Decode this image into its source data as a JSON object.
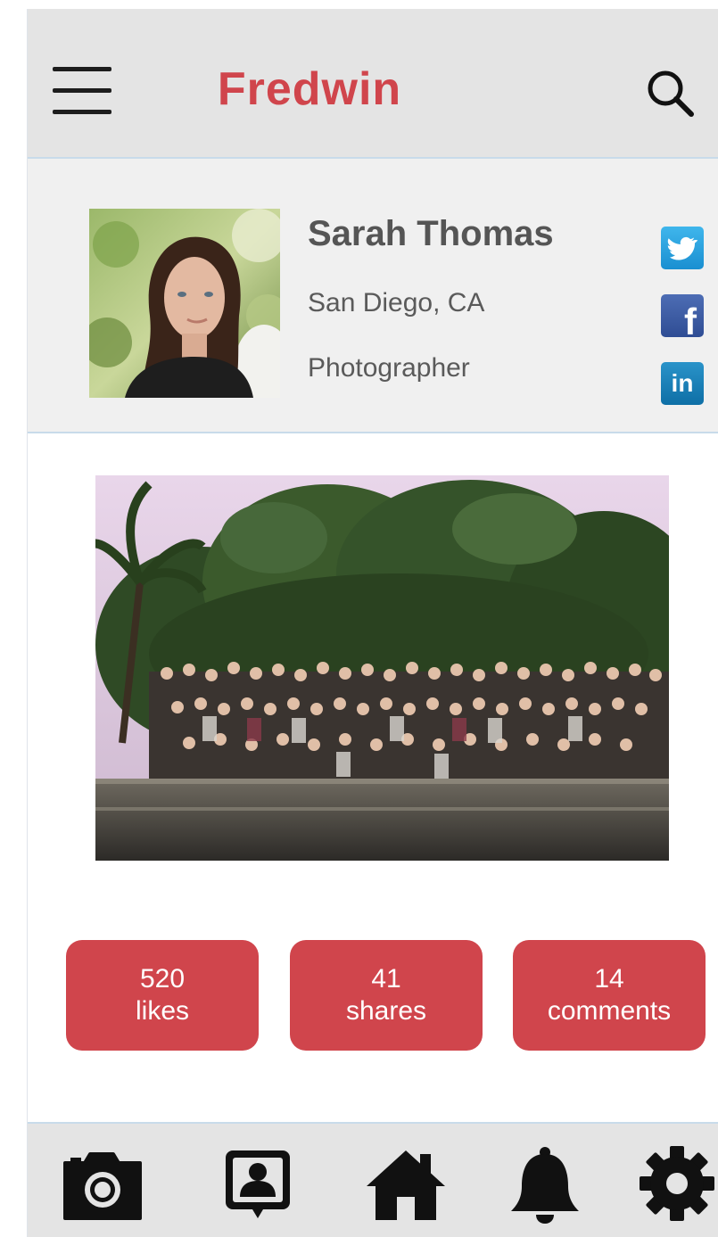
{
  "header": {
    "brand": "Fredwin",
    "menu_icon": "hamburger-menu-icon",
    "search_icon": "search-icon"
  },
  "profile": {
    "name": "Sarah Thomas",
    "location": "San Diego, CA",
    "occupation": "Photographer",
    "social": [
      {
        "icon": "twitter-icon",
        "color": "#1da1f2"
      },
      {
        "icon": "facebook-icon",
        "color": "#3b5998"
      },
      {
        "icon": "linkedin-icon",
        "color": "#0077b5"
      }
    ]
  },
  "photo": {
    "description_icon": "group-photo"
  },
  "stats": {
    "likes": {
      "count": "520",
      "label": "likes"
    },
    "shares": {
      "count": "41",
      "label": "shares"
    },
    "comments": {
      "count": "14",
      "label": "comments"
    }
  },
  "bottom_nav": [
    {
      "icon": "camera-icon"
    },
    {
      "icon": "profile-icon"
    },
    {
      "icon": "home-icon"
    },
    {
      "icon": "bell-icon"
    },
    {
      "icon": "gear-icon"
    }
  ],
  "colors": {
    "accent": "#d0454c",
    "header_bg": "#e4e4e4",
    "profile_bg": "#f0f0f0",
    "divider": "#c8dbea"
  }
}
